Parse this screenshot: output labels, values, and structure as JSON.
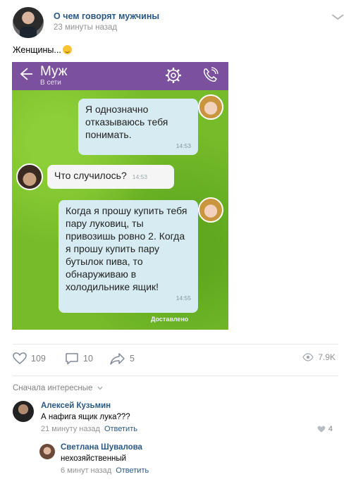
{
  "post": {
    "group_name": "О чем говорят мужчины",
    "time": "23 минуты назад",
    "text": "Женщины..."
  },
  "chat": {
    "contact_name": "Муж",
    "contact_status": "В сети",
    "messages": [
      {
        "text": "Я однозначно отказываюсь тебя понимать.",
        "time": "14:53",
        "from": "wife"
      },
      {
        "text": "Что случилось?",
        "time": "14:53",
        "from": "husband"
      },
      {
        "text": "Когда я прошу купить тебя пару луковиц, ты привозишь ровно 2. Когда я прошу купить пару бутылок пива, то обнаруживаю в холодильнике ящик!",
        "time": "14:55",
        "from": "wife"
      }
    ],
    "delivered": "Доставлено",
    "topbar_color": "#7b519d",
    "background_color": "#76bb2a"
  },
  "actions": {
    "likes": "109",
    "comments": "10",
    "shares": "5",
    "views": "7.9K"
  },
  "comments_sort": "Сначала интересные",
  "comments": [
    {
      "author": "Алексей Кузьмин",
      "text": "А нафига ящик лука???",
      "time": "21 минуту назад",
      "reply_label": "Ответить",
      "likes": "4"
    },
    {
      "author": "Светлана Шувалова",
      "text": "нехозяйственный",
      "time": "6 минут назад",
      "reply_label": "Ответить"
    }
  ]
}
